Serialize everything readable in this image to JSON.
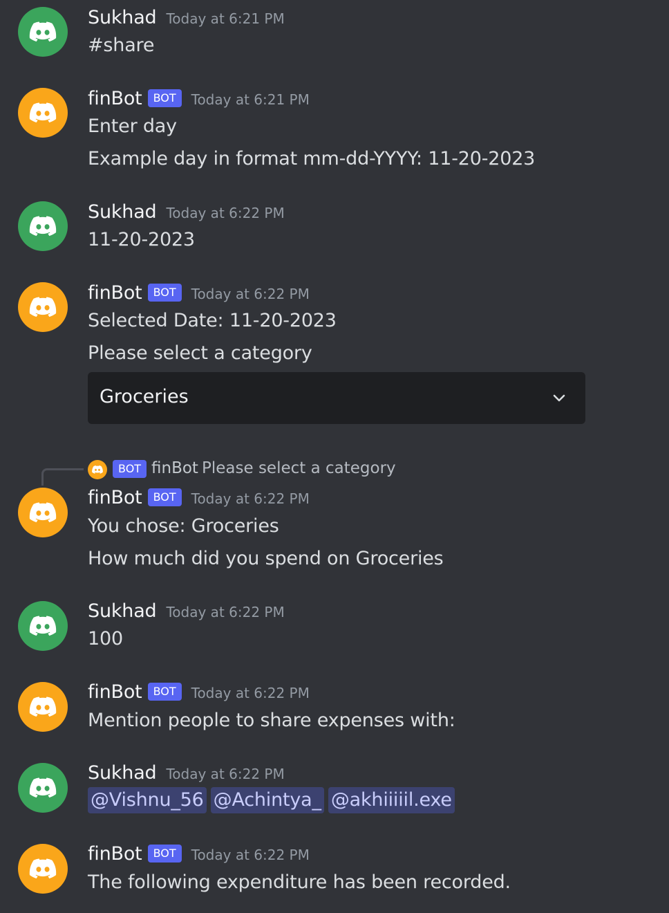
{
  "messages": [
    {
      "author": "Sukhad",
      "time": "Today at 6:21 PM",
      "lines": [
        "#share"
      ]
    },
    {
      "author": "finBot",
      "badge": "BOT",
      "time": "Today at 6:21 PM",
      "lines": [
        "Enter day",
        "Example day in format mm-dd-YYYY: 11-20-2023"
      ]
    },
    {
      "author": "Sukhad",
      "time": "Today at 6:22 PM",
      "lines": [
        "11-20-2023"
      ]
    },
    {
      "author": "finBot",
      "badge": "BOT",
      "time": "Today at 6:22 PM",
      "lines": [
        "Selected Date: 11-20-2023",
        "Please select a category"
      ],
      "select": {
        "value": "Groceries"
      }
    },
    {
      "author": "finBot",
      "badge": "BOT",
      "time": "Today at 6:22 PM",
      "reply": {
        "badge": "BOT",
        "author": "finBot",
        "text": "Please select a category"
      },
      "lines": [
        "You chose: Groceries",
        "How much did you spend on Groceries"
      ]
    },
    {
      "author": "Sukhad",
      "time": "Today at 6:22 PM",
      "lines": [
        "100"
      ]
    },
    {
      "author": "finBot",
      "badge": "BOT",
      "time": "Today at 6:22 PM",
      "lines": [
        "Mention people to share expenses with:"
      ]
    },
    {
      "author": "Sukhad",
      "time": "Today at 6:22 PM",
      "mentions": [
        "@Vishnu_56",
        "@Achintya_",
        "@akhiiiiil.exe"
      ]
    },
    {
      "author": "finBot",
      "badge": "BOT",
      "time": "Today at 6:22 PM",
      "lines": [
        "The following expenditure has been recorded."
      ]
    }
  ],
  "icons": {
    "avatar": "discord-logo-icon",
    "dropdown": "chevron-down-icon"
  },
  "colors": {
    "background": "#313338",
    "user_avatar": "#3ba55c",
    "bot_avatar": "#faa61a",
    "bot_badge": "#5865f2",
    "mention_bg": "#3c4270"
  }
}
